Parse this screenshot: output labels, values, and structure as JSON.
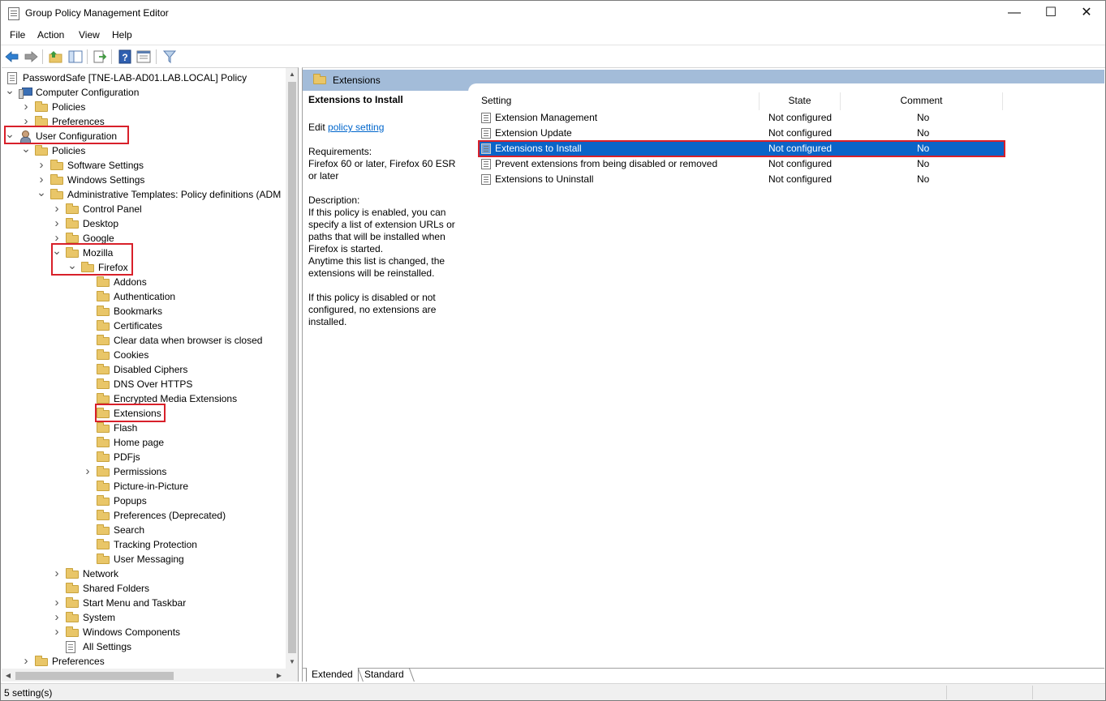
{
  "window": {
    "title": "Group Policy Management Editor",
    "minimize": "—",
    "maximize": "☐",
    "close": "✕"
  },
  "menu": [
    "File",
    "Action",
    "View",
    "Help"
  ],
  "tree": {
    "root": "PasswordSafe [TNE-LAB-AD01.LAB.LOCAL] Policy",
    "items": [
      {
        "label": "Computer Configuration",
        "icon": "computer-icon"
      },
      {
        "label": "Policies",
        "icon": "folder-icon"
      },
      {
        "label": "Preferences",
        "icon": "folder-icon"
      },
      {
        "label": "User Configuration",
        "icon": "user-icon"
      },
      {
        "label": "Policies",
        "icon": "folder-icon"
      },
      {
        "label": "Software Settings",
        "icon": "folder-icon"
      },
      {
        "label": "Windows Settings",
        "icon": "folder-icon"
      },
      {
        "label": "Administrative Templates: Policy definitions (ADM",
        "icon": "folder-icon"
      },
      {
        "label": "Control Panel",
        "icon": "folder-icon"
      },
      {
        "label": "Desktop",
        "icon": "folder-icon"
      },
      {
        "label": "Google",
        "icon": "folder-icon"
      },
      {
        "label": "Mozilla",
        "icon": "folder-icon"
      },
      {
        "label": "Firefox",
        "icon": "folder-icon"
      },
      {
        "label": "Addons",
        "icon": "folder-icon"
      },
      {
        "label": "Authentication",
        "icon": "folder-icon"
      },
      {
        "label": "Bookmarks",
        "icon": "folder-icon"
      },
      {
        "label": "Certificates",
        "icon": "folder-icon"
      },
      {
        "label": "Clear data when browser is closed",
        "icon": "folder-icon"
      },
      {
        "label": "Cookies",
        "icon": "folder-icon"
      },
      {
        "label": "Disabled Ciphers",
        "icon": "folder-icon"
      },
      {
        "label": "DNS Over HTTPS",
        "icon": "folder-icon"
      },
      {
        "label": "Encrypted Media Extensions",
        "icon": "folder-icon"
      },
      {
        "label": "Extensions",
        "icon": "folder-icon"
      },
      {
        "label": "Flash",
        "icon": "folder-icon"
      },
      {
        "label": "Home page",
        "icon": "folder-icon"
      },
      {
        "label": "PDFjs",
        "icon": "folder-icon"
      },
      {
        "label": "Permissions",
        "icon": "folder-icon"
      },
      {
        "label": "Picture-in-Picture",
        "icon": "folder-icon"
      },
      {
        "label": "Popups",
        "icon": "folder-icon"
      },
      {
        "label": "Preferences (Deprecated)",
        "icon": "folder-icon"
      },
      {
        "label": "Search",
        "icon": "folder-icon"
      },
      {
        "label": "Tracking Protection",
        "icon": "folder-icon"
      },
      {
        "label": "User Messaging",
        "icon": "folder-icon"
      },
      {
        "label": "Network",
        "icon": "folder-icon"
      },
      {
        "label": "Shared Folders",
        "icon": "folder-icon"
      },
      {
        "label": "Start Menu and Taskbar",
        "icon": "folder-icon"
      },
      {
        "label": "System",
        "icon": "folder-icon"
      },
      {
        "label": "Windows Components",
        "icon": "folder-icon"
      },
      {
        "label": "All Settings",
        "icon": "all-settings-icon"
      },
      {
        "label": "Preferences",
        "icon": "folder-icon"
      }
    ]
  },
  "right": {
    "header": "Extensions",
    "description": {
      "title": "Extensions to Install",
      "edit_prefix": "Edit ",
      "edit_link": "policy setting ",
      "requirements": "Requirements:\nFirefox 60 or later, Firefox 60 ESR or later",
      "description": "Description:\nIf this policy is enabled, you can specify a list of extension URLs or paths that will be installed when Firefox is started.\nAnytime this list is changed, the extensions will be reinstalled.\n\nIf this policy is disabled or not configured, no extensions are installed."
    },
    "columns": {
      "setting": "Setting",
      "state": "State",
      "comment": "Comment"
    },
    "rows": [
      {
        "setting": "Extension Management",
        "state": "Not configured",
        "comment": "No"
      },
      {
        "setting": "Extension Update",
        "state": "Not configured",
        "comment": "No"
      },
      {
        "setting": "Extensions to Install",
        "state": "Not configured",
        "comment": "No"
      },
      {
        "setting": "Prevent extensions from being disabled or removed",
        "state": "Not configured",
        "comment": "No"
      },
      {
        "setting": "Extensions to Uninstall",
        "state": "Not configured",
        "comment": "No"
      }
    ],
    "tabs": [
      "Extended",
      "Standard"
    ]
  },
  "status": "5 setting(s)",
  "colors": {
    "highlight": "#d8202a",
    "selection": "#0a64c8",
    "header": "#a3bcd9"
  }
}
